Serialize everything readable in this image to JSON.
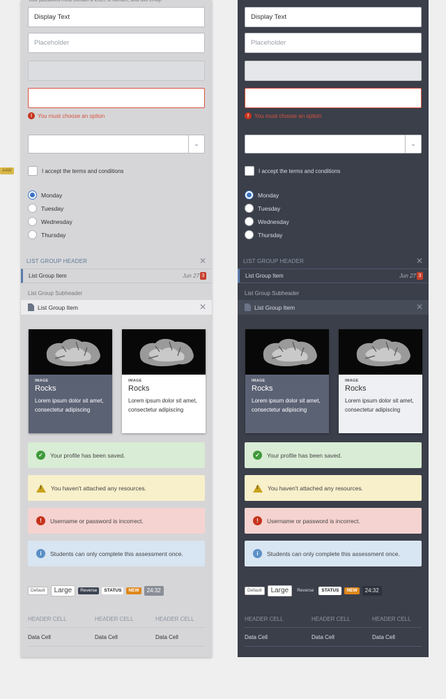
{
  "edge_label": "AAW",
  "panels": [
    {
      "id": "light",
      "hint": "Your password must contain a letter, a number, and two emoji.",
      "display_text": "Display Text",
      "placeholder": "Placeholder",
      "error_message": "You must choose an option",
      "checkbox_label": "I accept the terms and conditions",
      "radio_options": [
        "Monday",
        "Tuesday",
        "Wednesday",
        "Thursday"
      ],
      "radio_selected": "Monday",
      "list_group": {
        "header": "LIST GROUP HEADER",
        "item": "List Group Item",
        "date": "Jun 27",
        "badge": "3",
        "subheader": "List Group Subheader",
        "item2": "List Group Item"
      },
      "cards": [
        {
          "category": "IMAGE",
          "title": "Rocks",
          "description": "Lorem ipsum dolor sit amet, consectetur adipiscing"
        },
        {
          "category": "IMAGE",
          "title": "Rocks",
          "description": "Lorem ipsum dolor sit amet, consectetur adipiscing"
        }
      ],
      "alerts": {
        "success": "Your profile has been saved.",
        "warning": "You haven't attached any resources.",
        "error": "Username or password is incorrect.",
        "info": "Students can only complete this assessment once."
      },
      "tags": {
        "default": "Default",
        "large": "Large",
        "reverse": "Reverse",
        "status": "STATUS",
        "new": "NEW",
        "time": "24:32"
      },
      "table": {
        "headers": [
          "HEADER CELL",
          "HEADER CELL",
          "HEADER CELL"
        ],
        "cells": [
          "Data Cell",
          "Data Cell",
          "Data Cell"
        ]
      }
    },
    {
      "id": "dark",
      "hint": "",
      "display_text": "Display Text",
      "placeholder": "Placeholder",
      "error_message": "You must choose an option",
      "checkbox_label": "I accept the terms and conditions",
      "radio_options": [
        "Monday",
        "Tuesday",
        "Wednesday",
        "Thursday"
      ],
      "radio_selected": "Monday",
      "list_group": {
        "header": "LIST GROUP HEADER",
        "item": "List Group Item",
        "date": "Jun 27",
        "badge": "3",
        "subheader": "List Group Subheader",
        "item2": "List Group Item"
      },
      "cards": [
        {
          "category": "IMAGE",
          "title": "Rocks",
          "description": "Lorem ipsum dolor sit amet, consectetur adipiscing"
        },
        {
          "category": "IMAGE",
          "title": "Rocks",
          "description": "Lorem ipsum dolor sit amet, consectetur adipiscing"
        }
      ],
      "alerts": {
        "success": "Your profile has been saved.",
        "warning": "You haven't attached any resources.",
        "error": "Username or password is incorrect.",
        "info": "Students can only complete this assessment once."
      },
      "tags": {
        "default": "Default",
        "large": "Large",
        "reverse": "Reverse",
        "status": "STATUS",
        "new": "NEW",
        "time": "24:32"
      },
      "table": {
        "headers": [
          "HEADER CELL",
          "HEADER CELL",
          "HEADER CELL"
        ],
        "cells": [
          "Data Cell",
          "Data Cell",
          "Data Cell"
        ]
      }
    }
  ],
  "colors": {
    "accent": "#3b73c2",
    "error": "#d9533e",
    "success_icon": "#3e9a3a",
    "warning_icon": "#c9a21c",
    "info_icon": "#5a8fc7",
    "new_tag": "#e0871b",
    "dark_panel": "#3b3f4a"
  }
}
